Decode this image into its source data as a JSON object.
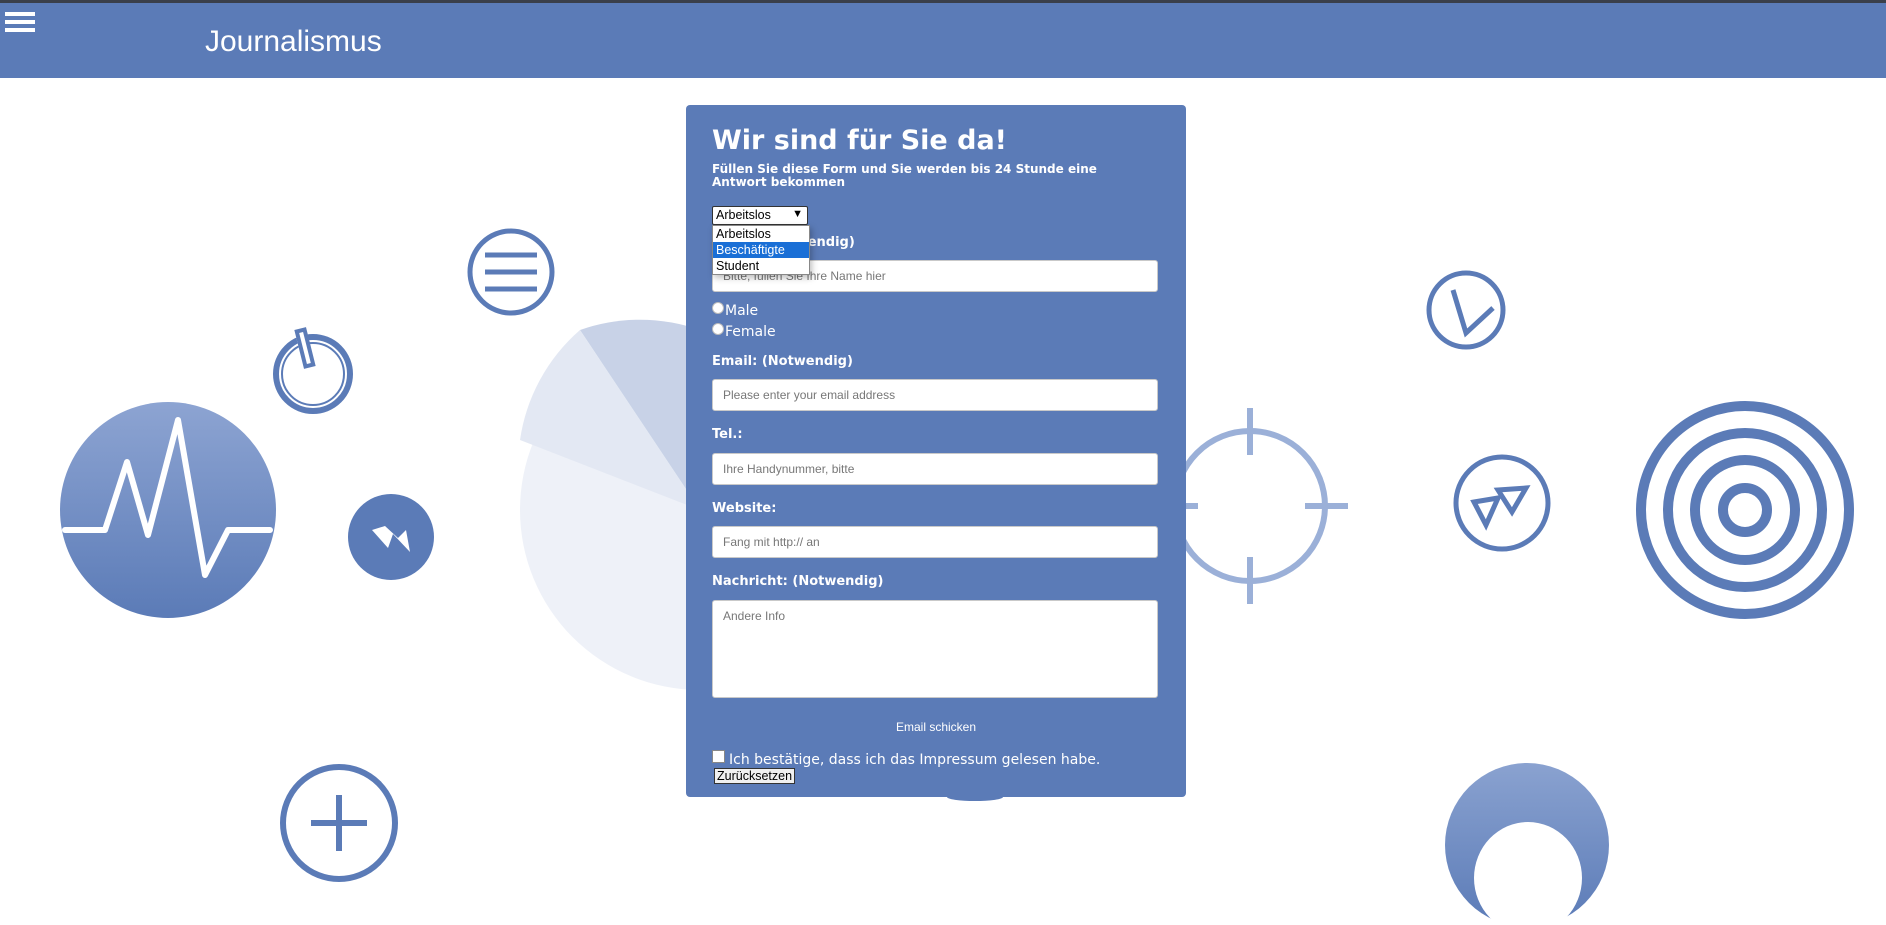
{
  "header": {
    "title": "Journalismus"
  },
  "form": {
    "title": "Wir sind für Sie da!",
    "subtitle": "Füllen Sie diese Form und Sie werden bis 24 Stunde eine Antwort bekommen",
    "status_select": {
      "value": "Arbeitslos",
      "options": [
        "Arbeitslos",
        "Beschäftigte",
        "Student"
      ],
      "highlighted": "Beschäftigte"
    },
    "name_label": "Name: (Notwendig)",
    "name_placeholder": "Bitte, füllen Sie Ihre Name hier",
    "gender": {
      "male": "Male",
      "female": "Female"
    },
    "email_label": "Email: (Notwendig)",
    "email_placeholder": "Please enter your email address",
    "phone_label": "Tel.:",
    "phone_placeholder": "Ihre Handynummer, bitte",
    "website_label": "Website:",
    "website_placeholder": "Fang mit http:// an",
    "message_label": "Nachricht: (Notwendig)",
    "message_placeholder": "Andere Info",
    "send_label": "Email schicken",
    "confirm_text": "Ich bestätige, dass ich das Impressum gelesen habe.",
    "reset_label": "Zurücksetzen"
  },
  "colors": {
    "primary": "#5b7bb7",
    "select_highlight": "#1a6fd6"
  },
  "background_icons": [
    "pulse-icon",
    "power-icon",
    "menu-circle-icon",
    "rewind-icon",
    "plus-circle-icon",
    "crosshair-icon",
    "clock-icon",
    "play-icon",
    "target-icon",
    "moon-icon"
  ]
}
